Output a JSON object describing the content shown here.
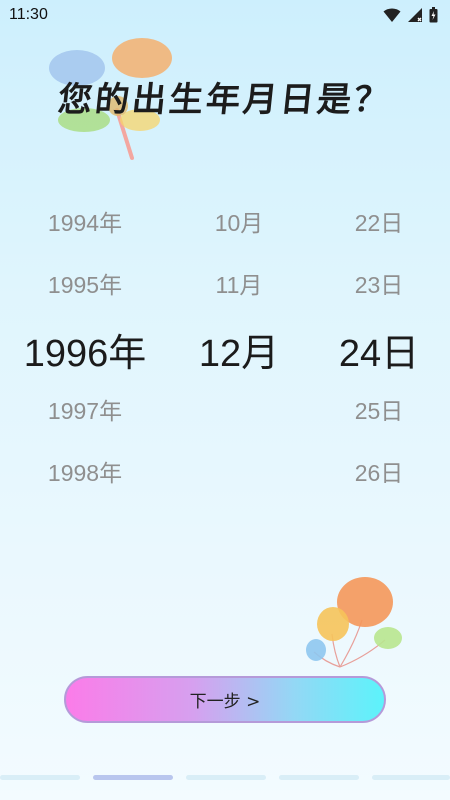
{
  "status_bar": {
    "time": "11:30",
    "icons": [
      "wifi-icon",
      "signal-icon",
      "battery-icon"
    ]
  },
  "title": "您的出生年月日是？",
  "picker": {
    "years": [
      "1994年",
      "1995年",
      "1996年",
      "1997年",
      "1998年"
    ],
    "months": [
      "10月",
      "11月",
      "12月"
    ],
    "days": [
      "22日",
      "23日",
      "24日",
      "25日",
      "26日"
    ],
    "selected": {
      "year": "1996年",
      "month": "12月",
      "day": "24日"
    }
  },
  "next_button": {
    "label": "下一步 >"
  },
  "page_indicator": {
    "count": 5,
    "active_index": 1
  },
  "colors": {
    "title": "#1c1c1c",
    "picker_unselected": "#8f8f8f",
    "picker_selected": "#1b1b1b",
    "button_gradient_start": "#fb7ce9",
    "button_gradient_end": "#5cf3fb"
  }
}
